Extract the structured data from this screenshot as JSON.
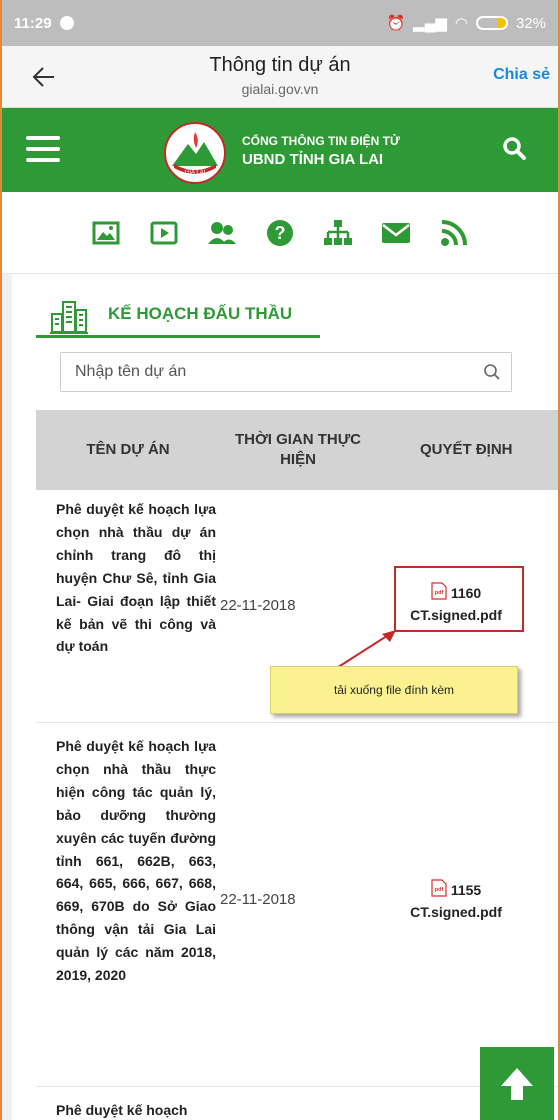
{
  "status_bar": {
    "time": "11:29",
    "battery": "32%",
    "battery_level": 0.32
  },
  "header": {
    "title": "Thông tin dự án",
    "domain": "gialai.gov.vn",
    "share_label": "Chia sẻ"
  },
  "site": {
    "line1": "CỔNG THÔNG TIN ĐIỆN TỬ",
    "line2": "UBND TỈNH GIA LAI",
    "logo_text": "GIA LAI"
  },
  "icons": [
    "image-icon",
    "video-icon",
    "users-icon",
    "help-icon",
    "sitemap-icon",
    "mail-icon",
    "rss-icon"
  ],
  "section": {
    "title": "KẾ HOẠCH ĐẤU THẦU"
  },
  "search": {
    "placeholder": "Nhập tên dự án"
  },
  "table": {
    "columns": [
      "TÊN DỰ ÁN",
      "THỜI GIAN THỰC HIỆN",
      "QUYẾT ĐỊNH"
    ],
    "rows": [
      {
        "name": "Phê duyệt kế hoạch lựa chọn nhà thầu dự án chỉnh trang đô thị huyện Chư Sê, tỉnh Gia Lai- Giai đoạn lập thiết kế bản vẽ thi công và dự toán",
        "date": "22-11-2018",
        "file_number": "1160",
        "file_name": "CT.signed.pdf"
      },
      {
        "name": "Phê duyệt kế hoạch lựa chọn nhà thầu thực hiện công tác quản lý, bảo dưỡng thường xuyên các tuyến đường tỉnh 661, 662B, 663, 664, 665, 666, 667, 668, 669, 670B do Sở Giao thông vận tải Gia Lai quản lý các năm 2018, 2019, 2020",
        "date": "22-11-2018",
        "file_number": "1155",
        "file_name": "CT.signed.pdf"
      },
      {
        "name": "Phê duyệt kế hoạch",
        "date": "",
        "file_number": "",
        "file_name": ""
      }
    ]
  },
  "tooltip": {
    "text": "tải xuống file đính kèm"
  },
  "colors": {
    "brand_green": "#2e9a36",
    "link_blue": "#1a88e0",
    "highlight_red": "#c62828",
    "tooltip_yellow": "#fbf28f"
  }
}
